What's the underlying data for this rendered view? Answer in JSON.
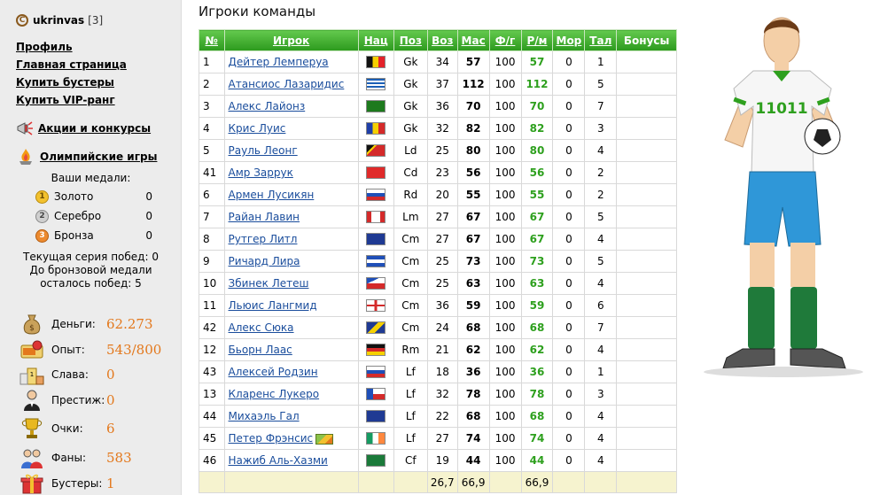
{
  "user": {
    "name": "ukrinvas",
    "level": "[3]"
  },
  "nav": [
    "Профиль",
    "Главная страница",
    "Купить бустеры",
    "Купить VIP-ранг"
  ],
  "promos": {
    "actions": "Акции и конкурсы",
    "olympic": "Олимпийские игры"
  },
  "medals": {
    "title": "Ваши медали:",
    "items": [
      {
        "icon": "gold-medal-icon",
        "num": "1",
        "label": "Золото",
        "value": "0"
      },
      {
        "icon": "silver-medal-icon",
        "num": "2",
        "label": "Серебро",
        "value": "0"
      },
      {
        "icon": "bronze-medal-icon",
        "num": "3",
        "label": "Бронза",
        "value": "0"
      }
    ]
  },
  "streak": {
    "line1": "Текущая серия побед: 0",
    "line2": "До бронзовой медали",
    "line3": "осталось побед: 5"
  },
  "stats": [
    {
      "icon": "money-bag-icon",
      "label": "Деньги:",
      "value": "62.273"
    },
    {
      "icon": "experience-icon",
      "label": "Опыт:",
      "value": "543/800"
    },
    {
      "icon": "podium-icon",
      "label": "Слава:",
      "value": "0"
    },
    {
      "icon": "prestige-icon",
      "label": "Престиж:",
      "value": "0"
    },
    {
      "icon": "trophy-icon",
      "label": "Очки:",
      "value": "6"
    },
    {
      "icon": "fans-icon",
      "label": "Фаны:",
      "value": "583"
    },
    {
      "icon": "gift-icon",
      "label": "Бустеры:",
      "value": "1"
    }
  ],
  "main": {
    "title": "Игроки команды",
    "columns": [
      "№",
      "Игрок",
      "Нац",
      "Поз",
      "Воз",
      "Мас",
      "Ф/г",
      "Р/м",
      "Мор",
      "Тал",
      "Бонусы"
    ]
  },
  "players": [
    {
      "no": "1",
      "name": "Дейтер Лемперуа",
      "flag": "be",
      "pos": "Gk",
      "age": "34",
      "mas": "57",
      "fg": "100",
      "rm": "57",
      "mor": "0",
      "tal": "1"
    },
    {
      "no": "2",
      "name": "Атансиос Лазаридис",
      "flag": "gr",
      "pos": "Gk",
      "age": "37",
      "mas": "112",
      "fg": "100",
      "rm": "112",
      "mor": "0",
      "tal": "5"
    },
    {
      "no": "3",
      "name": "Алекс Лайонз",
      "flag": "dm",
      "pos": "Gk",
      "age": "36",
      "mas": "70",
      "fg": "100",
      "rm": "70",
      "mor": "0",
      "tal": "7"
    },
    {
      "no": "4",
      "name": "Крис Луис",
      "flag": "md",
      "pos": "Gk",
      "age": "32",
      "mas": "82",
      "fg": "100",
      "rm": "82",
      "mor": "0",
      "tal": "3"
    },
    {
      "no": "5",
      "name": "Рауль Леонг",
      "flag": "tl",
      "pos": "Ld",
      "age": "25",
      "mas": "80",
      "fg": "100",
      "rm": "80",
      "mor": "0",
      "tal": "4"
    },
    {
      "no": "41",
      "name": "Амр Заррук",
      "flag": "tn",
      "pos": "Cd",
      "age": "23",
      "mas": "56",
      "fg": "100",
      "rm": "56",
      "mor": "0",
      "tal": "2"
    },
    {
      "no": "6",
      "name": "Армен Лусикян",
      "flag": "ru",
      "pos": "Rd",
      "age": "20",
      "mas": "55",
      "fg": "100",
      "rm": "55",
      "mor": "0",
      "tal": "2"
    },
    {
      "no": "7",
      "name": "Райан Лавин",
      "flag": "ca",
      "pos": "Lm",
      "age": "27",
      "mas": "67",
      "fg": "100",
      "rm": "67",
      "mor": "0",
      "tal": "5"
    },
    {
      "no": "8",
      "name": "Рутгер Литл",
      "flag": "au",
      "pos": "Cm",
      "age": "27",
      "mas": "67",
      "fg": "100",
      "rm": "67",
      "mor": "0",
      "tal": "4"
    },
    {
      "no": "9",
      "name": "Ричард Лира",
      "flag": "sv",
      "pos": "Cm",
      "age": "25",
      "mas": "73",
      "fg": "100",
      "rm": "73",
      "mor": "0",
      "tal": "5"
    },
    {
      "no": "10",
      "name": "Збинек Летеш",
      "flag": "cz",
      "pos": "Cm",
      "age": "25",
      "mas": "63",
      "fg": "100",
      "rm": "63",
      "mor": "0",
      "tal": "4"
    },
    {
      "no": "11",
      "name": "Льюис Лангмид",
      "flag": "en",
      "pos": "Cm",
      "age": "36",
      "mas": "59",
      "fg": "100",
      "rm": "59",
      "mor": "0",
      "tal": "6"
    },
    {
      "no": "42",
      "name": "Алекс Сюка",
      "flag": "ba",
      "pos": "Cm",
      "age": "24",
      "mas": "68",
      "fg": "100",
      "rm": "68",
      "mor": "0",
      "tal": "7"
    },
    {
      "no": "12",
      "name": "Бьорн Лаас",
      "flag": "de",
      "pos": "Rm",
      "age": "21",
      "mas": "62",
      "fg": "100",
      "rm": "62",
      "mor": "0",
      "tal": "4"
    },
    {
      "no": "43",
      "name": "Алексей Родзин",
      "flag": "ru",
      "pos": "Lf",
      "age": "18",
      "mas": "36",
      "fg": "100",
      "rm": "36",
      "mor": "0",
      "tal": "1"
    },
    {
      "no": "13",
      "name": "Кларенс Лукеро",
      "flag": "cl",
      "pos": "Lf",
      "age": "32",
      "mas": "78",
      "fg": "100",
      "rm": "78",
      "mor": "0",
      "tal": "3"
    },
    {
      "no": "44",
      "name": "Михаэль Гал",
      "flag": "au",
      "pos": "Lf",
      "age": "22",
      "mas": "68",
      "fg": "100",
      "rm": "68",
      "mor": "0",
      "tal": "4"
    },
    {
      "no": "45",
      "name": "Петер Фрэнсис",
      "flag": "ie",
      "pos": "Lf",
      "age": "27",
      "mas": "74",
      "fg": "100",
      "rm": "74",
      "mor": "0",
      "tal": "4",
      "bonus_icon": true
    },
    {
      "no": "46",
      "name": "Нажиб Аль-Хазми",
      "flag": "sa",
      "pos": "Cf",
      "age": "19",
      "mas": "44",
      "fg": "100",
      "rm": "44",
      "mor": "0",
      "tal": "4"
    }
  ],
  "footer": {
    "age": "26,7",
    "mas": "66,9",
    "rm": "66,9"
  },
  "art": {
    "shirt_text": "11011"
  }
}
